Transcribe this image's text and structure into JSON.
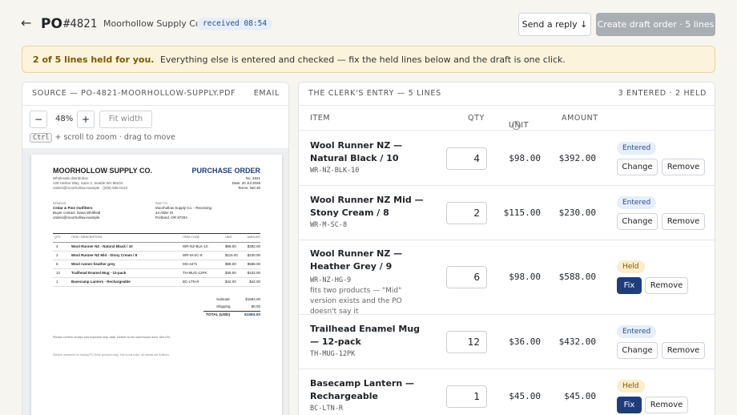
{
  "header": {
    "back_icon": "←",
    "po_label": "PO",
    "po_number": "#4821",
    "vendor": "Moorhollow Supply Co.",
    "received": "received 08:54",
    "reply_button": "Send a reply ↓",
    "draft_button": "Create draft order · 5 lines"
  },
  "banner": {
    "bold": "2 of 5 lines held for you.",
    "text": "Everything else is entered and checked — fix the held lines below and the draft is one click."
  },
  "source": {
    "title": "SOURCE — PO-4821-MOORHOLLOW-SUPPLY.PDF",
    "tab": "EMAIL",
    "zoom_minus": "−",
    "zoom_value": "48%",
    "zoom_plus": "+",
    "fit_width": "Fit width",
    "kbd": "Ctrl",
    "hint": "+ scroll to zoom · drag to move"
  },
  "pdf": {
    "company": "MOORHOLLOW SUPPLY CO.",
    "tagline": "Wholesale distribution",
    "address": "128 Harbor Way, Suite 4, Seattle WA 98104",
    "contact": "orders@moorhollow.example · (206) 555-0142",
    "doc_title": "PURCHASE ORDER",
    "po_no": "No. 4821",
    "date": "Date: 20 Jul 2026",
    "terms": "Terms: Net 30",
    "vendor_label": "VENDOR",
    "vendor_lines": [
      "Cedar & Pine Outfitters",
      "Buyer contact: Dana Whitfield",
      "orders@moorhollow.example"
    ],
    "shipto_label": "SHIP TO",
    "shipto_lines": [
      "Moorhollow Supply Co. - Receiving",
      "44 Alder St",
      "Portland, OR 97204"
    ],
    "col_qty": "QTY",
    "col_item": "ITEM / DESCRIPTION",
    "col_code": "ITEM CODE",
    "col_unit": "UNIT",
    "col_amount": "AMOUNT",
    "lines": [
      {
        "qty": "4",
        "item": "Wool Runner NZ - Natural Black / 10",
        "code": "WR-NZ-BLK-10",
        "unit": "$98.00",
        "amount": "$392.00"
      },
      {
        "qty": "2",
        "item": "Wool Runner NZ Mid - Stony Cream / 8",
        "code": "WR-M-SC-8",
        "unit": "$115.00",
        "amount": "$230.00"
      },
      {
        "qty": "6",
        "item": "Wool runner heather grey",
        "code": "MS-4471",
        "unit": "$98.00",
        "amount": "$588.00"
      },
      {
        "qty": "12",
        "item": "Trailhead Enamel Mug - 12-pack",
        "code": "TH-MUG-12PK",
        "unit": "$36.00",
        "amount": "$432.00"
      },
      {
        "qty": "1",
        "item": "Basecamp Lantern - Rechargeable",
        "code": "BC-LTN-R",
        "unit": "$42.00",
        "amount": "$42.00"
      }
    ],
    "subtotal_label": "Subtotal",
    "subtotal": "$1684.00",
    "shipping_label": "Shipping",
    "shipping": "$0.00",
    "total_label": "TOTAL (USD)",
    "total": "$1684.00",
    "footer1": "Please confirm receipt and expected ship date. Deliver to the warehouse dock, Mon-Fri.",
    "footer2": "Sample document for testing PO-Desk (product only). Not a real order; all names are fictitious."
  },
  "entry": {
    "title": "THE CLERK'S ENTRY — 5 LINES",
    "summary": "3 ENTERED · 2 HELD",
    "col_item": "ITEM",
    "col_qty": "QTY",
    "col_unit": "UNIT",
    "col_unit_help": "?",
    "col_amount": "AMOUNT",
    "rows": [
      {
        "name": "Wool Runner NZ — Natural Black / 10",
        "sku": "WR-NZ-BLK-10",
        "qty": "4",
        "unit": "$98.00",
        "amount": "$392.00",
        "status": "Entered",
        "action1": "Change",
        "action2": "Remove"
      },
      {
        "name": "Wool Runner NZ Mid — Stony Cream / 8",
        "sku": "WR-M-SC-8",
        "qty": "2",
        "unit": "$115.00",
        "amount": "$230.00",
        "status": "Entered",
        "action1": "Change",
        "action2": "Remove"
      },
      {
        "name": "Wool Runner NZ — Heather Grey / 9",
        "sku": "WR-NZ-HG-9",
        "note": "fits two products — \"Mid\" version exists and the PO doesn't say it",
        "qty": "6",
        "unit": "$98.00",
        "amount": "$588.00",
        "status": "Held",
        "action1": "Fix",
        "action2": "Remove"
      },
      {
        "name": "Trailhead Enamel Mug — 12-pack",
        "sku": "TH-MUG-12PK",
        "qty": "12",
        "unit": "$36.00",
        "amount": "$432.00",
        "status": "Entered",
        "action1": "Change",
        "action2": "Remove"
      },
      {
        "name": "Basecamp Lantern — Rechargeable",
        "sku": "BC-LTN-R",
        "qty": "1",
        "unit": "$45.00",
        "amount": "$45.00",
        "status": "Held",
        "action1": "Fix",
        "action2": "Remove"
      }
    ]
  }
}
